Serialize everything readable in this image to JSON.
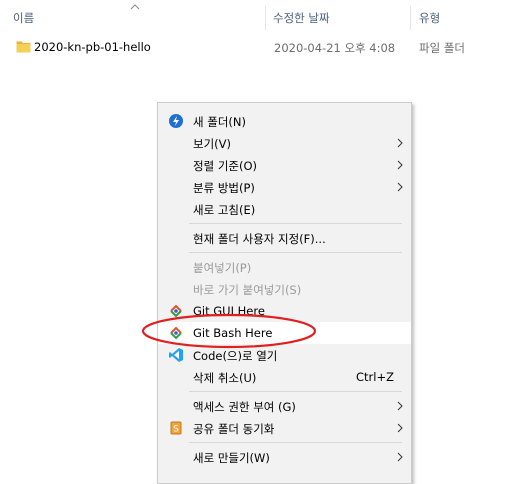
{
  "header": {
    "name": "이름",
    "date_modified": "수정한 날짜",
    "type": "유형"
  },
  "file": {
    "name": "2020-kn-pb-01-hello",
    "date": "2020-04-21 오후 4:08",
    "type": "파일 폴더"
  },
  "menu": {
    "new_folder": "새 폴더(N)",
    "view": "보기(V)",
    "sort_by": "정렬 기준(O)",
    "group_by": "분류 방법(P)",
    "refresh": "새로 고침(E)",
    "customize": "현재 폴더 사용자 지정(F)...",
    "paste": "붙여넣기(P)",
    "paste_shortcut": "바로 가기 붙여넣기(S)",
    "git_gui": "Git GUI Here",
    "git_bash": "Git Bash Here",
    "open_code": "Code(으)로 열기",
    "undo_delete": "삭제 취소(U)",
    "undo_delete_shortcut": "Ctrl+Z",
    "give_access": "액세스 권한 부여 (G)",
    "sync_shared": "공유 폴더 동기화",
    "new": "새로 만들기(W)"
  },
  "colors": {
    "annotation": "#e02020",
    "vscode_blue": "#23a2f0",
    "folder_yellow": "#f4c542",
    "git_red": "#e5502e"
  }
}
